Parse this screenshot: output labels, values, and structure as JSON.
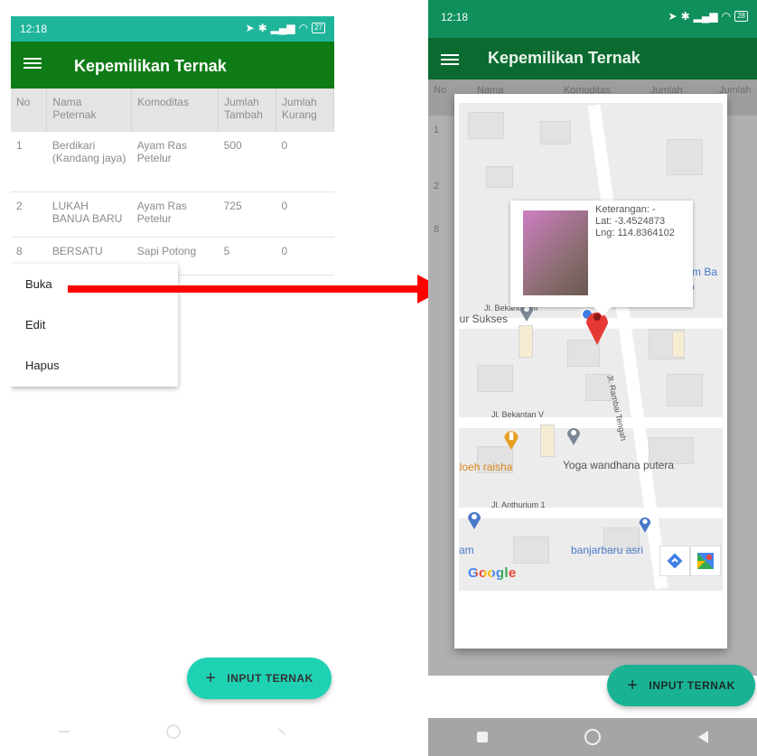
{
  "left_screen": {
    "status": {
      "time": "12:18",
      "battery": "27"
    },
    "appbar": {
      "title": "Kepemilikan Ternak"
    },
    "table": {
      "headers": [
        "No",
        "Nama Peternak",
        "Komoditas",
        "Jumlah Tambah",
        "Jumlah Kurang"
      ],
      "rows": [
        [
          "1",
          "Berdikari (Kandang jaya)",
          "Ayam Ras Petelur",
          "500",
          "0"
        ],
        [
          "2",
          "LUKAH BANUA BARU",
          "Ayam Ras Petelur",
          "725",
          "0"
        ],
        [
          "8",
          "BERSATU",
          "Sapi Potong",
          "5",
          "0"
        ]
      ]
    },
    "context_menu": {
      "items": [
        "Buka",
        "Edit",
        "Hapus"
      ]
    },
    "fab": {
      "label": "INPUT TERNAK"
    }
  },
  "right_screen": {
    "status": {
      "time": "12:18",
      "battery": "28"
    },
    "appbar": {
      "title": "Kepemilikan Ternak"
    },
    "table_header_visible": [
      "No",
      "Nama",
      "Komoditas",
      "Jumlah",
      "Jumlah"
    ],
    "row_numbers_visible": [
      "1",
      "2",
      "8"
    ],
    "map": {
      "info_window": {
        "keterangan": "Keterangan: -",
        "lat": "Lat: -3.4524873",
        "lng": "Lng: 114.8364102"
      },
      "street_labels": [
        "Jl. Bekantan III",
        "Jl. Rambai Tengah",
        "Jl. Bekantan V",
        "Jl. Anthurium 1"
      ],
      "poi_labels": [
        "salam Ba",
        "our Sukses",
        "aloeh raisha",
        "Yoga wandhana putera",
        "yam",
        "banjarbaru asri"
      ],
      "google_logo": "Google"
    },
    "fab": {
      "label": "INPUT TERNAK"
    }
  },
  "colors": {
    "status_left": "#1fb59b",
    "appbar_left": "#0f7b16",
    "fab": "#1fd1b3",
    "arrow": "#ff0000",
    "marker": "#e53935"
  }
}
